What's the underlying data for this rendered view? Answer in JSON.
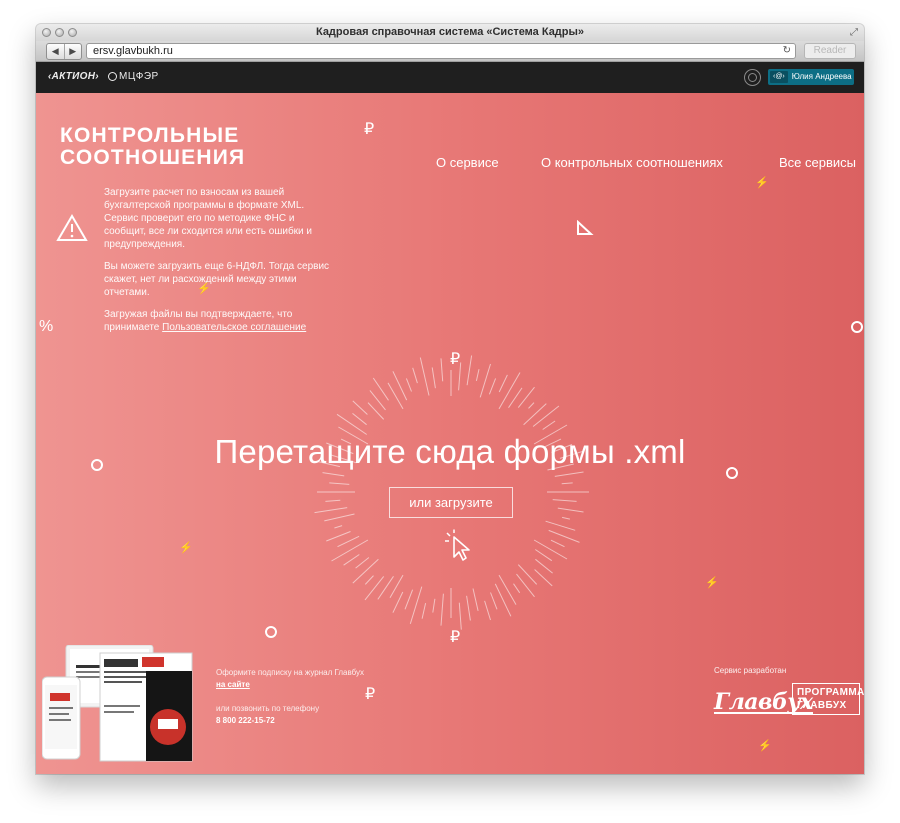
{
  "browser": {
    "window_title": "Кадровая справочная система «Система Кадры»",
    "url": "ersv.glavbukh.ru",
    "reader_label": "Reader"
  },
  "site_header": {
    "logo_aktion": "‹АКТИОН›",
    "logo_mcfer": "МЦФЭР",
    "user_badge_prefix": "‹@›",
    "user_name": "Юлия Андреева"
  },
  "hero": {
    "brand_line1": "КОНТРОЛЬНЫЕ",
    "brand_line2": "СООТНОШЕНИЯ",
    "nav": [
      "О сервисе",
      "О контрольных соотношениях",
      "Все сервисы"
    ],
    "intro": {
      "p1": "Загрузите расчет по взносам из вашей бухгалтерской программы в формате XML. Сервис проверит его по методике ФНС и сообщит, все ли сходится или есть ошибки и предупреждения.",
      "p2": "Вы можете загрузить еще 6-НДФЛ. Тогда сервис скажет, нет ли расхождений между этими отчетами.",
      "p3_prefix": "Загружая файлы вы подтверждаете, что принимаете ",
      "p3_link": "Пользовательское соглашение"
    },
    "drop_title": "Перетащите сюда формы .xml",
    "upload_label": "или загрузите"
  },
  "decorations": {
    "ruble": "₽",
    "percent": "%",
    "bolt": "⚡"
  },
  "footer": {
    "subscribe_text": "Оформите подписку на журнал Главбух",
    "subscribe_link": "на сайте",
    "phone_prompt": "или позвонить по телефону",
    "phone": "8 800 222-15-72",
    "developer_label": "Сервис разработан",
    "glavbuh_logo": "Главбух",
    "program_logo_line1": "ПРОГРАММА",
    "program_logo_line2": "ГЛАВБУХ"
  },
  "colors": {
    "bg_left": "#ef9491",
    "bg_right": "#db6161",
    "header_bg": "#1f1f1f",
    "user_badge": "#0d6e85"
  }
}
